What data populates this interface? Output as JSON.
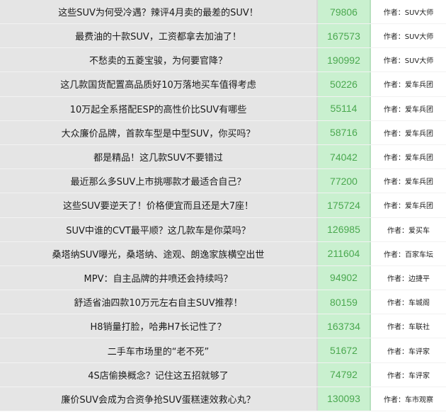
{
  "rows": [
    {
      "title": "这些SUV为何受冷遇？辣评4月卖的最差的SUV！",
      "views": "79806",
      "author": "作者：SUV大师"
    },
    {
      "title": "最费油的十款SUV，工资都拿去加油了！",
      "views": "167573",
      "author": "作者：SUV大师"
    },
    {
      "title": "不愁卖的五菱宝骏，为何要官降？",
      "views": "190992",
      "author": "作者：SUV大师"
    },
    {
      "title": "这几款国货配置高品质好10万落地买车值得考虑",
      "views": "50226",
      "author": "作者：爱车兵团"
    },
    {
      "title": "10万起全系搭配ESP的高性价比SUV有哪些",
      "views": "55114",
      "author": "作者：爱车兵团"
    },
    {
      "title": "大众廉价品牌，首款车型是中型SUV，你买吗？",
      "views": "58716",
      "author": "作者：爱车兵团"
    },
    {
      "title": "都是精品！这几款SUV不要错过",
      "views": "74042",
      "author": "作者：爱车兵团"
    },
    {
      "title": "最近那么多SUV上市挑哪款才最适合自己？",
      "views": "77200",
      "author": "作者：爱车兵团"
    },
    {
      "title": "这些SUV要逆天了！价格便宜而且还是大7座！",
      "views": "175724",
      "author": "作者：爱车兵团"
    },
    {
      "title": "SUV中谁的CVT最平顺？这几款车是你菜吗？",
      "views": "126985",
      "author": "作者：爱买车"
    },
    {
      "title": "桑塔纳SUV曝光，桑塔纳、途观、朗逸家族横空出世",
      "views": "211604",
      "author": "作者：百家车坛"
    },
    {
      "title": "MPV：自主品牌的井喷还会持续吗？",
      "views": "94902",
      "author": "作者：边捷平"
    },
    {
      "title": "舒适省油四款10万元左右自主SUV推荐！",
      "views": "80159",
      "author": "作者：车城阁"
    },
    {
      "title": "H8销量打脸，哈弗H7长记性了？",
      "views": "163734",
      "author": "作者：车联社"
    },
    {
      "title": "二手车市场里的“老不死”",
      "views": "51672",
      "author": "作者：车评家"
    },
    {
      "title": "4S店偷换概念？记住这五招就够了",
      "views": "74792",
      "author": "作者：车评家"
    },
    {
      "title": "廉价SUV会成为合资争抢SUV蛋糕速效救心丸？",
      "views": "130093",
      "author": "作者：车市观察"
    }
  ]
}
